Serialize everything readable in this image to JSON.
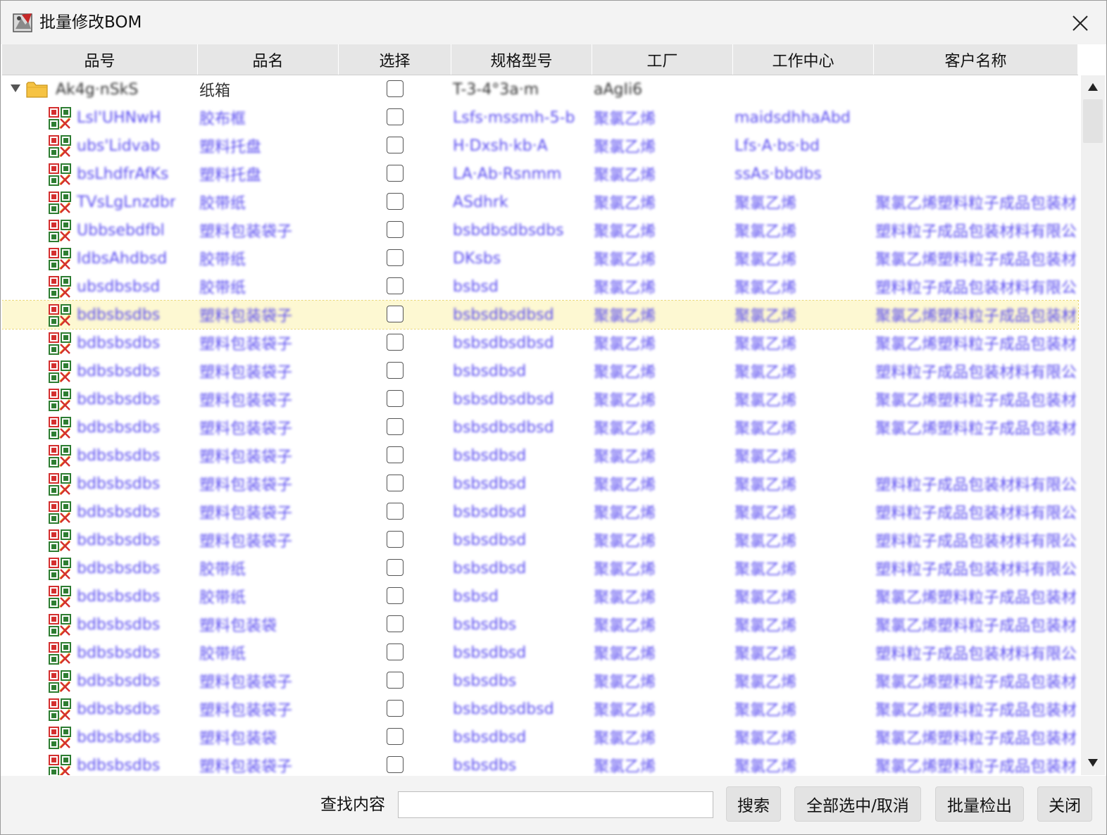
{
  "window": {
    "title": "批量修改BOM"
  },
  "columns": [
    "品号",
    "品名",
    "选择",
    "规格型号",
    "工厂",
    "工作中心",
    "客户名称"
  ],
  "tree": {
    "root": {
      "item_no": "Ak4g·nSkS",
      "name": "纸箱",
      "spec": "T-3-4°3a·m",
      "factory": "aAgIi6"
    },
    "rows": [
      {
        "item_no": "Lsl'UHNwH",
        "name": "胶布框",
        "spec": "Lsfs·mssmh-5-b",
        "factory": "聚氯乙烯",
        "work_center": "maidsdhhaAbd",
        "customer": ""
      },
      {
        "item_no": "ubs'Lidvab",
        "name": "塑料托盘",
        "spec": "H·Dxsh·kb·A",
        "factory": "聚氯乙烯",
        "work_center": "Lfs·A·bs·bd",
        "customer": ""
      },
      {
        "item_no": "bsLhdfrAfKs",
        "name": "塑料托盘",
        "spec": "LA·Ab·Rsnmm",
        "factory": "聚氯乙烯",
        "work_center": "ssAs·bbdbs",
        "customer": ""
      },
      {
        "item_no": "TVsLgLnzdbr",
        "name": "胶带纸",
        "spec": "ASdhrk",
        "factory": "聚氯乙烯",
        "work_center": "聚氯乙烯",
        "customer": "聚氯乙烯塑料粒子成品包装材料"
      },
      {
        "item_no": "Ubbsebdfbl",
        "name": "塑料包装袋子",
        "spec": "bsbdbsdbsdbs",
        "factory": "聚氯乙烯",
        "work_center": "聚氯乙烯",
        "customer": "塑料粒子成品包装材料有限公司"
      },
      {
        "item_no": "IdbsAhdbsd",
        "name": "胶带纸",
        "spec": "DKsbs",
        "factory": "聚氯乙烯",
        "work_center": "聚氯乙烯",
        "customer": "聚氯乙烯塑料粒子成品包装材料"
      },
      {
        "item_no": "ubsdbsbsd",
        "name": "胶带纸",
        "spec": "bsbsd",
        "factory": "聚氯乙烯",
        "work_center": "聚氯乙烯",
        "customer": "塑料粒子成品包装材料有限公司"
      },
      {
        "item_no": "bdbsbsdbs",
        "name": "塑料包装袋子",
        "spec": "bsbsdbsdbsd",
        "factory": "聚氯乙烯",
        "work_center": "聚氯乙烯",
        "customer": "聚氯乙烯塑料粒子成品包装材料"
      },
      {
        "item_no": "bdbsbsdbs",
        "name": "塑料包装袋子",
        "spec": "bsbsdbsdbsd",
        "factory": "聚氯乙烯",
        "work_center": "聚氯乙烯",
        "customer": "聚氯乙烯塑料粒子成品包装材料"
      },
      {
        "item_no": "bdbsbsdbs",
        "name": "塑料包装袋子",
        "spec": "bsbsdbsd",
        "factory": "聚氯乙烯",
        "work_center": "聚氯乙烯",
        "customer": "塑料粒子成品包装材料有限公司"
      },
      {
        "item_no": "bdbsbsdbs",
        "name": "塑料包装袋子",
        "spec": "bsbsdbsdbsd",
        "factory": "聚氯乙烯",
        "work_center": "聚氯乙烯",
        "customer": "聚氯乙烯塑料粒子成品包装材料"
      },
      {
        "item_no": "bdbsbsdbs",
        "name": "塑料包装袋子",
        "spec": "bsbsdbsdbsd",
        "factory": "聚氯乙烯",
        "work_center": "聚氯乙烯",
        "customer": "聚氯乙烯塑料粒子成品包装材料"
      },
      {
        "item_no": "bdbsbsdbs",
        "name": "塑料包装袋子",
        "spec": "bsbsdbsd",
        "factory": "聚氯乙烯",
        "work_center": "聚氯乙烯",
        "customer": ""
      },
      {
        "item_no": "bdbsbsdbs",
        "name": "塑料包装袋子",
        "spec": "bsbsdbsd",
        "factory": "聚氯乙烯",
        "work_center": "聚氯乙烯",
        "customer": "塑料粒子成品包装材料有限公司"
      },
      {
        "item_no": "bdbsbsdbs",
        "name": "塑料包装袋子",
        "spec": "bsbsdbsd",
        "factory": "聚氯乙烯",
        "work_center": "聚氯乙烯",
        "customer": "塑料粒子成品包装材料有限公司"
      },
      {
        "item_no": "bdbsbsdbs",
        "name": "塑料包装袋子",
        "spec": "bsbsdbsd",
        "factory": "聚氯乙烯",
        "work_center": "聚氯乙烯",
        "customer": "塑料粒子成品包装材料有限公司"
      },
      {
        "item_no": "bdbsbsdbs",
        "name": "胶带纸",
        "spec": "bsbsdbsd",
        "factory": "聚氯乙烯",
        "work_center": "聚氯乙烯",
        "customer": "塑料粒子成品包装材料有限公司"
      },
      {
        "item_no": "bdbsbsdbs",
        "name": "胶带纸",
        "spec": "bsbsd",
        "factory": "聚氯乙烯",
        "work_center": "聚氯乙烯",
        "customer": "聚氯乙烯塑料粒子成品包装材料"
      },
      {
        "item_no": "bdbsbsdbs",
        "name": "塑料包装袋",
        "spec": "bsbsdbs",
        "factory": "聚氯乙烯",
        "work_center": "聚氯乙烯",
        "customer": "聚氯乙烯塑料粒子成品包装材料"
      },
      {
        "item_no": "bdbsbsdbs",
        "name": "胶带纸",
        "spec": "bsbsdbsd",
        "factory": "聚氯乙烯",
        "work_center": "聚氯乙烯",
        "customer": "塑料粒子成品包装材料有限公司"
      },
      {
        "item_no": "bdbsbsdbs",
        "name": "塑料包装袋子",
        "spec": "bsbsdbs",
        "factory": "聚氯乙烯",
        "work_center": "聚氯乙烯",
        "customer": "聚氯乙烯塑料粒子成品包装材料"
      },
      {
        "item_no": "bdbsbsdbs",
        "name": "塑料包装袋子",
        "spec": "bsbsdbsdbsd",
        "factory": "聚氯乙烯",
        "work_center": "聚氯乙烯",
        "customer": "聚氯乙烯塑料粒子成品包装材料"
      },
      {
        "item_no": "bdbsbsdbs",
        "name": "塑料包装袋",
        "spec": "bsbsdbsd",
        "factory": "聚氯乙烯",
        "work_center": "聚氯乙烯",
        "customer": "聚氯乙烯塑料粒子成品包装材料"
      },
      {
        "item_no": "bdbsbsdbs",
        "name": "塑料包装袋子",
        "spec": "bsbsdbs",
        "factory": "聚氯乙烯",
        "work_center": "聚氯乙烯",
        "customer": "聚氯乙烯塑料粒子成品包装材料"
      }
    ]
  },
  "selected_row_index": 7,
  "footer": {
    "search_label": "查找内容",
    "search_value": "",
    "search_button": "搜索",
    "toggle_all_button": "全部选中/取消",
    "export_button": "批量检出",
    "close_button": "关闭"
  },
  "icons": {
    "app": "app-icon",
    "close": "close-icon",
    "expander": "triangle-down-icon",
    "folder": "folder-icon",
    "node": "bom-item-icon",
    "scroll_up": "arrow-up-icon",
    "scroll_down": "arrow-down-icon"
  }
}
